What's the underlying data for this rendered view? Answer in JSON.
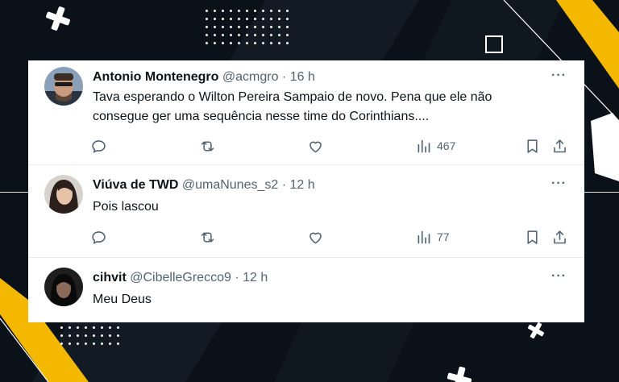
{
  "tweets": [
    {
      "name": "Antonio Montenegro",
      "handle": "@acmgro",
      "dot": "·",
      "time": "16 h",
      "lines": [
        "Tava esperando o Wilton Pereira Sampaio de novo. Pena que ele não",
        "consegue ger uma sequência nesse time do Corinthians...."
      ],
      "views": "467"
    },
    {
      "name": "Viúva de TWD",
      "handle": "@umaNunes_s2",
      "dot": "·",
      "time": "12 h",
      "lines": [
        "Pois lascou"
      ],
      "views": "77"
    },
    {
      "name": "cihvit",
      "handle": "@CibelleGrecco9",
      "dot": "·",
      "time": "12 h",
      "lines": [
        "Meu Deus"
      ]
    }
  ],
  "more_glyph": "···",
  "icons": [
    "reply-icon",
    "retweet-icon",
    "like-icon",
    "views-icon",
    "bookmark-icon",
    "share-icon",
    "more-icon"
  ],
  "colors": {
    "background": "#0b1118",
    "accent_yellow": "#f5b800",
    "text_primary": "#0f1419",
    "text_secondary": "#536471"
  }
}
